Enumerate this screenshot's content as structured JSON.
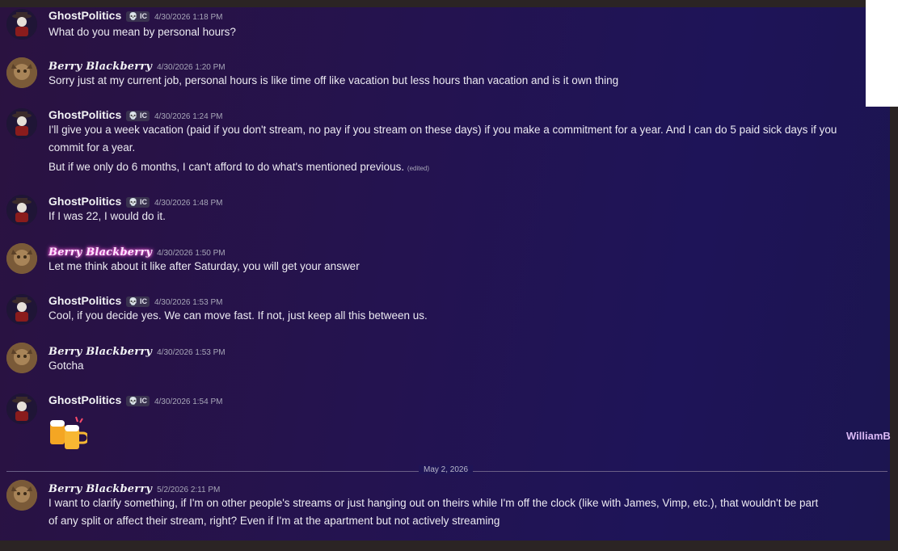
{
  "messages": [
    {
      "author": "GhostPolitics",
      "tag": "💀 IC",
      "time": "4/30/2026 1:18 PM",
      "lines": [
        "What do you mean by personal hours?"
      ]
    },
    {
      "author": "Berry Blackberry",
      "time": "4/30/2026 1:20 PM",
      "lines": [
        "Sorry just at my current job, personal hours is like time off like vacation but less hours than vacation and is it own thing"
      ]
    },
    {
      "author": "GhostPolitics",
      "tag": "💀 IC",
      "time": "4/30/2026 1:24 PM",
      "lines": [
        "I'll give you a week vacation (paid if you don't stream, no pay if you stream on these days) if you make a commitment for a year. And I can do 5 paid sick days if you",
        "commit for a year.",
        "But if we only do 6 months, I can't afford to do what's mentioned previous."
      ],
      "edited": "(edited)"
    },
    {
      "author": "GhostPolitics",
      "tag": "💀 IC",
      "time": "4/30/2026 1:48 PM",
      "lines": [
        "If I was 22, I would do it."
      ]
    },
    {
      "author": "Berry Blackberry",
      "time": "4/30/2026 1:50 PM",
      "lines": [
        "Let me think about it like after Saturday, you will get your answer"
      ]
    },
    {
      "author": "GhostPolitics",
      "tag": "💀 IC",
      "time": "4/30/2026 1:53 PM",
      "lines": [
        "Cool, if you decide yes. We can move fast. If not, just keep all this between us."
      ]
    },
    {
      "author": "Berry Blackberry",
      "time": "4/30/2026 1:53 PM",
      "lines": [
        "Gotcha"
      ]
    },
    {
      "author": "GhostPolitics",
      "tag": "💀 IC",
      "time": "4/30/2026 1:54 PM",
      "emoji": "clinking-beer-mugs"
    },
    {
      "author": "Berry Blackberry",
      "time": "5/2/2026 2:11 PM",
      "lines": [
        "I want to clarify something, if I'm on other people's streams or just hanging out on theirs while I'm off the clock (like with James, Vimp, etc.), that wouldn't be part",
        "of any split or affect their stream, right? Even if I'm at the apartment but not actively streaming"
      ]
    }
  ],
  "divider_label": "May 2, 2026",
  "side_name": "WilliamB",
  "colors": {
    "accent_glow": "#ff5ce1",
    "text": "#eceaf2",
    "timestamp": "#a7a6b8"
  }
}
